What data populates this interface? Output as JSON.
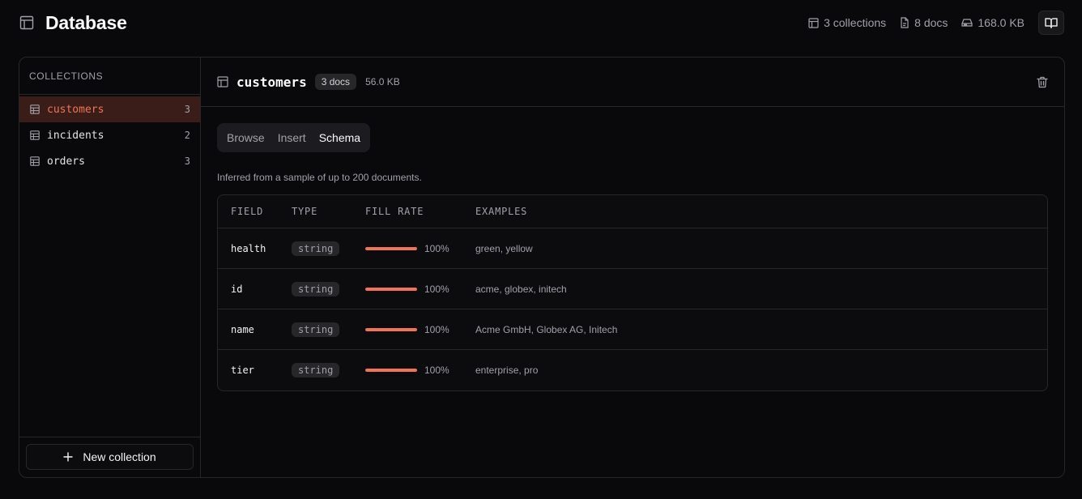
{
  "header": {
    "title": "Database",
    "stats": {
      "collections": "3 collections",
      "docs": "8 docs",
      "size": "168.0 KB"
    }
  },
  "sidebar": {
    "heading": "COLLECTIONS",
    "items": [
      {
        "name": "customers",
        "count": "3",
        "active": true
      },
      {
        "name": "incidents",
        "count": "2",
        "active": false
      },
      {
        "name": "orders",
        "count": "3",
        "active": false
      }
    ],
    "new_button_label": "New collection"
  },
  "collection": {
    "name": "customers",
    "docs_badge": "3 docs",
    "size": "56.0 KB"
  },
  "tabs": [
    {
      "label": "Browse",
      "active": false
    },
    {
      "label": "Insert",
      "active": false
    },
    {
      "label": "Schema",
      "active": true
    }
  ],
  "schema": {
    "note": "Inferred from a sample of up to 200 documents.",
    "columns": [
      "FIELD",
      "TYPE",
      "FILL RATE",
      "EXAMPLES"
    ],
    "rows": [
      {
        "field": "health",
        "type": "string",
        "fill_rate": 100,
        "fill_label": "100%",
        "examples": "green, yellow"
      },
      {
        "field": "id",
        "type": "string",
        "fill_rate": 100,
        "fill_label": "100%",
        "examples": "acme, globex, initech"
      },
      {
        "field": "name",
        "type": "string",
        "fill_rate": 100,
        "fill_label": "100%",
        "examples": "Acme GmbH, Globex AG, Initech"
      },
      {
        "field": "tier",
        "type": "string",
        "fill_rate": 100,
        "fill_label": "100%",
        "examples": "enterprise, pro"
      }
    ]
  },
  "colors": {
    "accent": "#f07457",
    "active_bg": "#3a1d19",
    "background": "#09090b"
  },
  "icons": {
    "title": "table-icon",
    "collections_stat": "table-icon",
    "docs_stat": "file-icon",
    "size_stat": "hard-drive-icon",
    "docs_button": "book-open-icon",
    "collection_item": "table-icon",
    "new_collection": "plus-icon",
    "delete": "trash-icon"
  }
}
